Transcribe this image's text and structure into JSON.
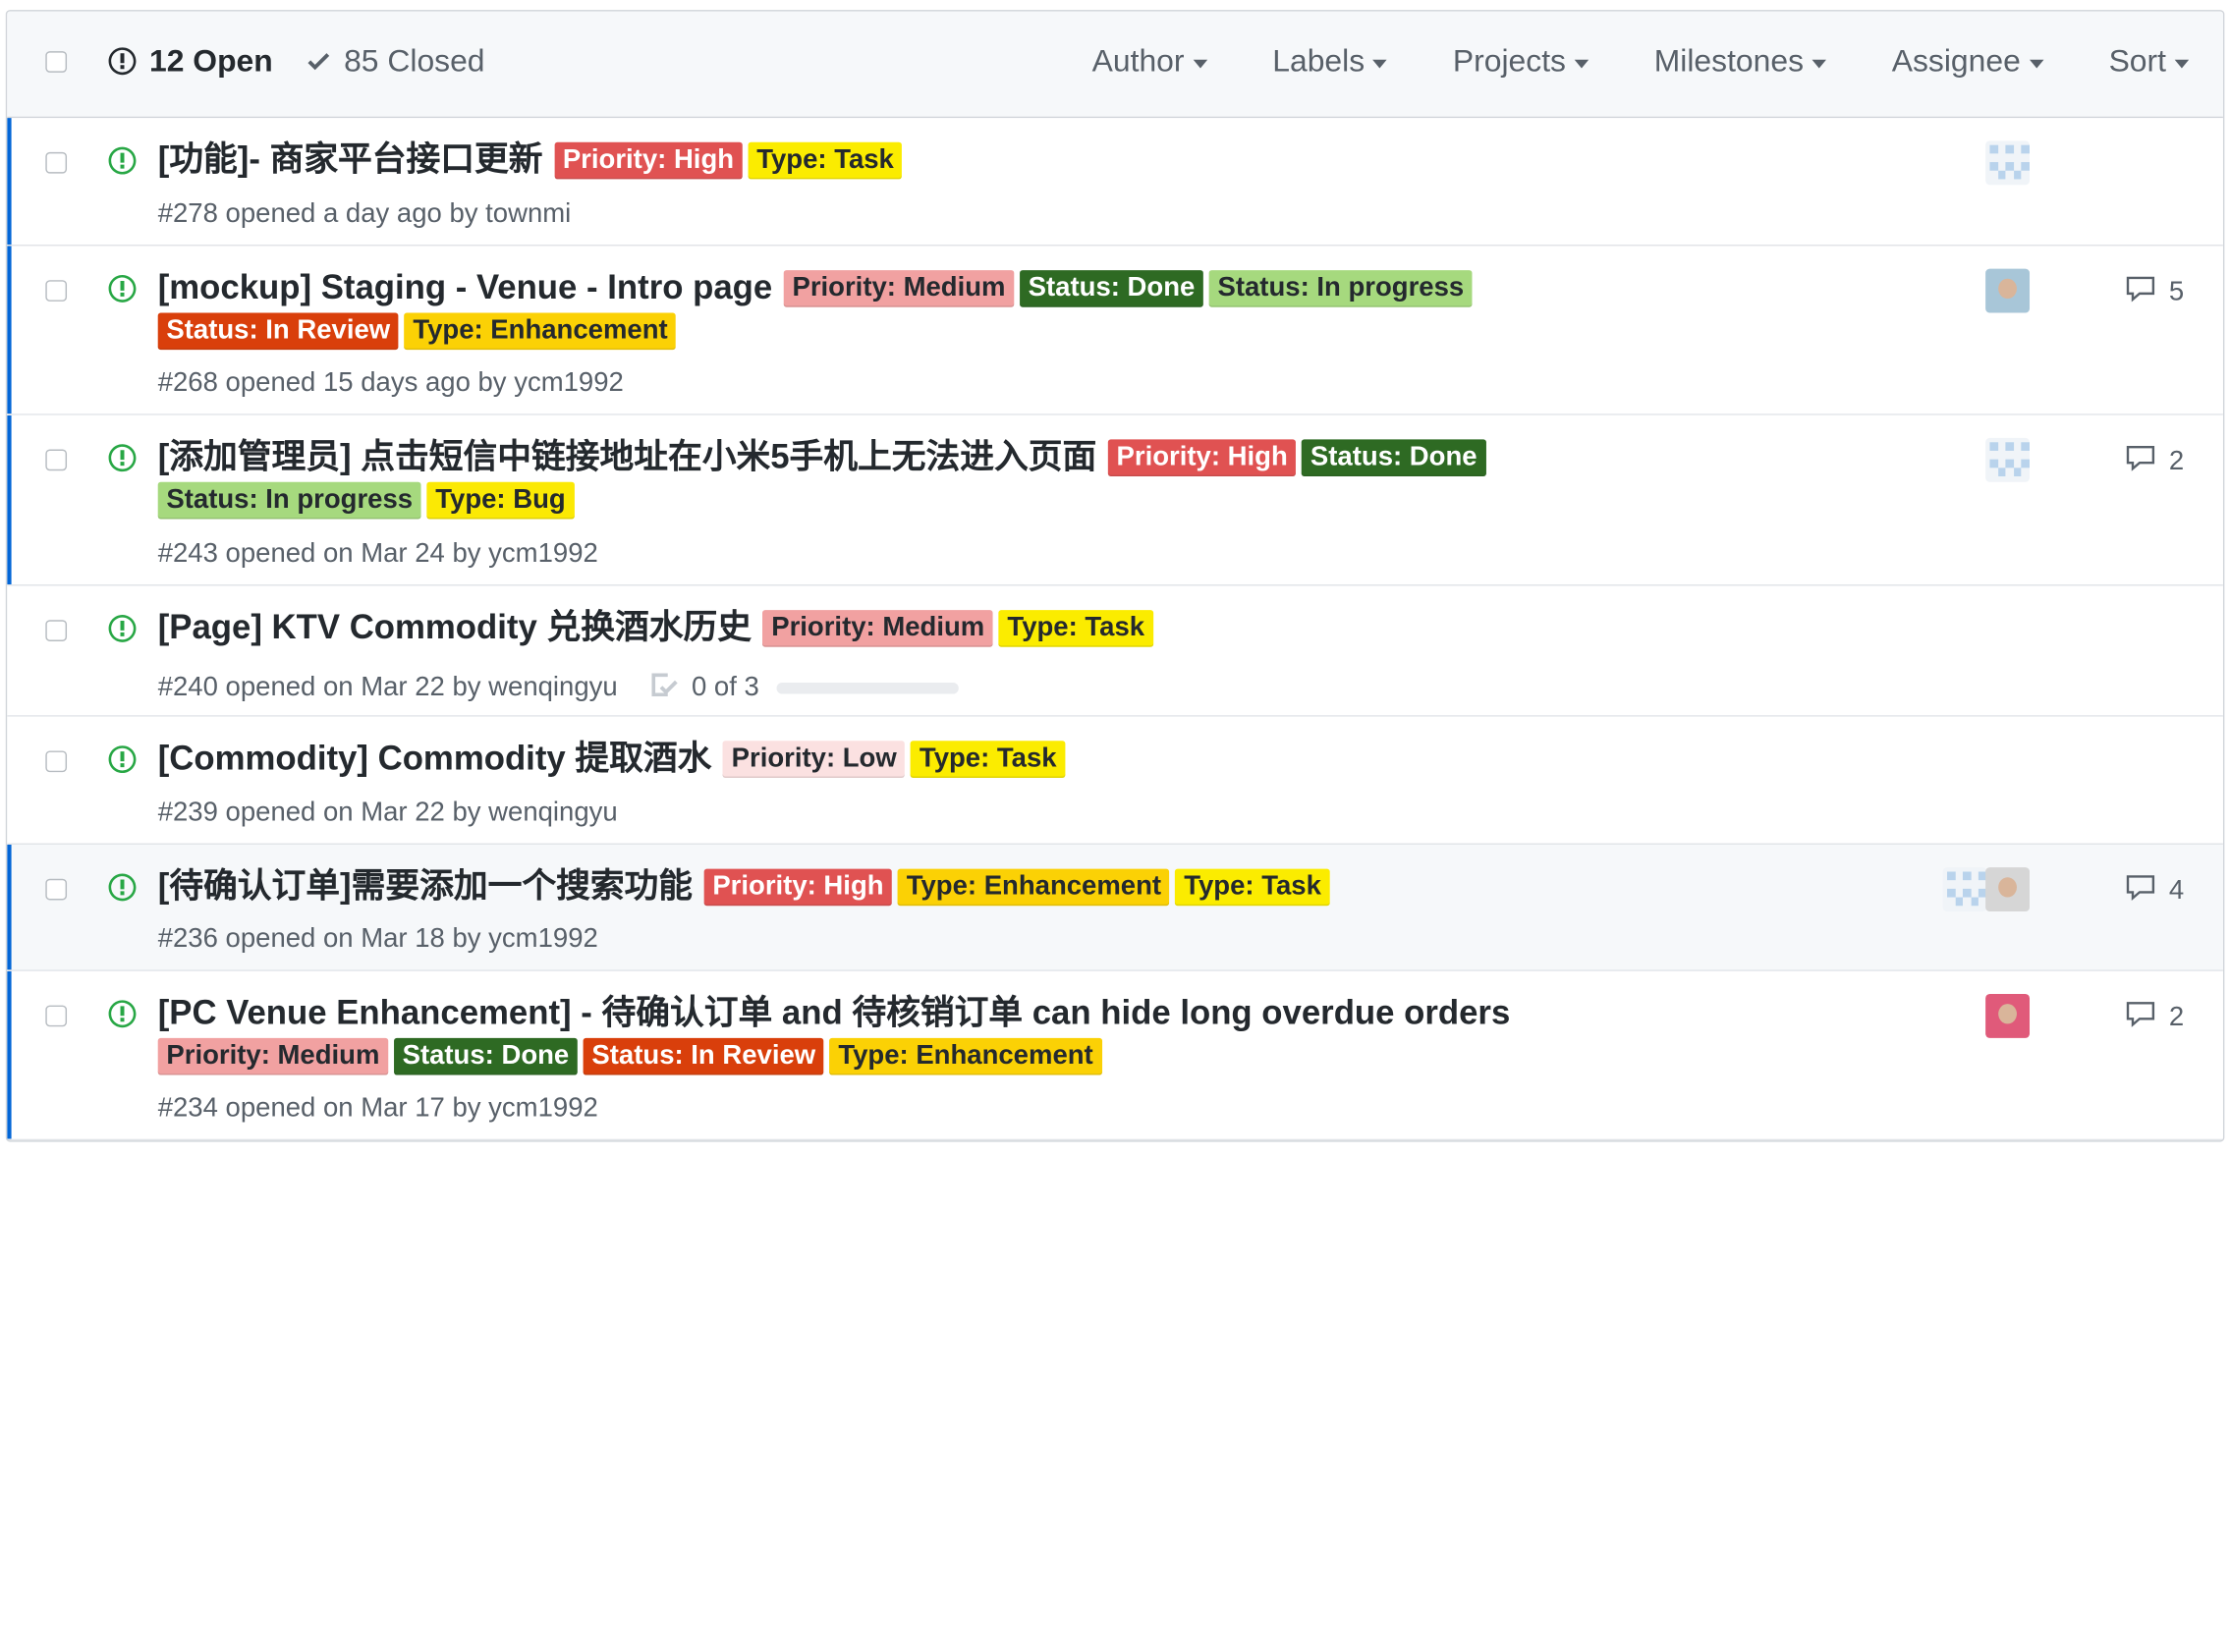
{
  "header": {
    "open_count": "12 Open",
    "closed_count": "85 Closed",
    "filters": [
      "Author",
      "Labels",
      "Projects",
      "Milestones",
      "Assignee",
      "Sort"
    ]
  },
  "colors": {
    "open_icon": "#28a745",
    "unread_bar": "#0366d6",
    "priority_high": "#e05252",
    "priority_medium": "#f1a1a1",
    "priority_low": "#fbe1e1",
    "type_task": "#fbec00",
    "type_enhancement": "#fbd105",
    "type_bug": "#fbe904",
    "status_done": "#2e6a23",
    "status_in_progress": "#a6d97e",
    "status_in_review": "#d93f0b"
  },
  "issues": [
    {
      "title": "[功能]- 商家平台接口更新",
      "labels": [
        {
          "text": "Priority: High",
          "kind": "priority_high"
        },
        {
          "text": "Type: Task",
          "kind": "type_task"
        }
      ],
      "meta": "#278 opened a day ago by townmi",
      "tasks": null,
      "assignee_icon": "identicon-avatar",
      "comments": null
    },
    {
      "title": "[mockup] Staging - Venue - Intro page",
      "labels": [
        {
          "text": "Priority: Medium",
          "kind": "priority_medium"
        },
        {
          "text": "Status: Done",
          "kind": "status_done"
        },
        {
          "text": "Status: In progress",
          "kind": "status_in_progress"
        },
        {
          "text": "Status: In Review",
          "kind": "status_in_review"
        },
        {
          "text": "Type: Enhancement",
          "kind": "type_enhancement"
        }
      ],
      "meta": "#268 opened 15 days ago by ycm1992",
      "tasks": null,
      "assignee_icon": "photo-avatar",
      "comments": "5"
    },
    {
      "title": "[添加管理员] 点击短信中链接地址在小米5手机上无法进入页面",
      "labels": [
        {
          "text": "Priority: High",
          "kind": "priority_high"
        },
        {
          "text": "Status: Done",
          "kind": "status_done"
        },
        {
          "text": "Status: In progress",
          "kind": "status_in_progress"
        },
        {
          "text": "Type: Bug",
          "kind": "type_bug"
        }
      ],
      "meta": "#243 opened on Mar 24 by ycm1992",
      "tasks": null,
      "assignee_icon": "identicon-avatar",
      "comments": "2"
    },
    {
      "title": "[Page] KTV Commodity 兑换酒水历史",
      "labels": [
        {
          "text": "Priority: Medium",
          "kind": "priority_medium"
        },
        {
          "text": "Type: Task",
          "kind": "type_task"
        }
      ],
      "meta": "#240 opened on Mar 22 by wenqingyu",
      "tasks": {
        "text": "0 of 3",
        "progress": 0
      },
      "assignee_icon": null,
      "comments": null
    },
    {
      "title": "[Commodity] Commodity 提取酒水",
      "labels": [
        {
          "text": "Priority: Low",
          "kind": "priority_low"
        },
        {
          "text": "Type: Task",
          "kind": "type_task"
        }
      ],
      "meta": "#239 opened on Mar 22 by wenqingyu",
      "tasks": null,
      "assignee_icon": null,
      "comments": null
    },
    {
      "title": "[待确认订单]需要添加一个搜索功能",
      "labels": [
        {
          "text": "Priority: High",
          "kind": "priority_high"
        },
        {
          "text": "Type: Enhancement",
          "kind": "type_enhancement"
        },
        {
          "text": "Type: Task",
          "kind": "type_task"
        }
      ],
      "meta": "#236 opened on Mar 18 by ycm1992",
      "tasks": null,
      "assignee_icon": "two-avatars",
      "comments": "4"
    },
    {
      "title": "[PC Venue Enhancement] - 待确认订单 and 待核销订单 can hide long overdue orders",
      "labels": [
        {
          "text": "Priority: Medium",
          "kind": "priority_medium"
        },
        {
          "text": "Status: Done",
          "kind": "status_done"
        },
        {
          "text": "Status: In Review",
          "kind": "status_in_review"
        },
        {
          "text": "Type: Enhancement",
          "kind": "type_enhancement"
        }
      ],
      "meta": "#234 opened on Mar 17 by ycm1992",
      "tasks": null,
      "assignee_icon": "photo-avatar",
      "comments": "2"
    }
  ]
}
